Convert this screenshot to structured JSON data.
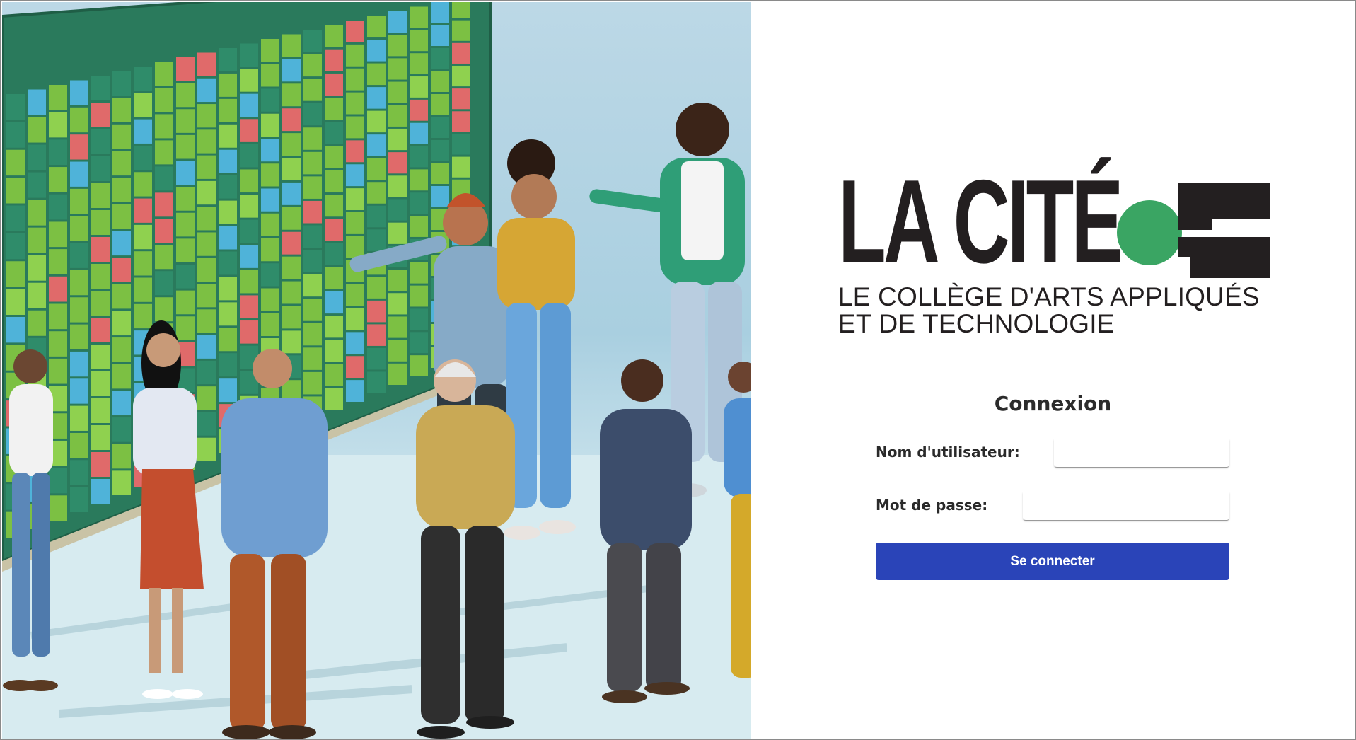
{
  "hero": {
    "illustration": "team-planning-schedule-board-illustration"
  },
  "logo": {
    "wordmark": "LA CITÉ",
    "tagline_line1": "LE COLLÈGE D'ARTS APPLIQUÉS",
    "tagline_line2": "ET DE TECHNOLOGIE",
    "colors": {
      "text": "#231f20",
      "dot": "#3aa563"
    }
  },
  "login": {
    "title": "Connexion",
    "username_label": "Nom d'utilisateur:",
    "username_value": "",
    "password_label": "Mot de passe:",
    "password_value": "",
    "submit_label": "Se connecter"
  },
  "colors": {
    "button": "#2a44b8",
    "button_text": "#ffffff",
    "panel_bg": "#ffffff"
  }
}
